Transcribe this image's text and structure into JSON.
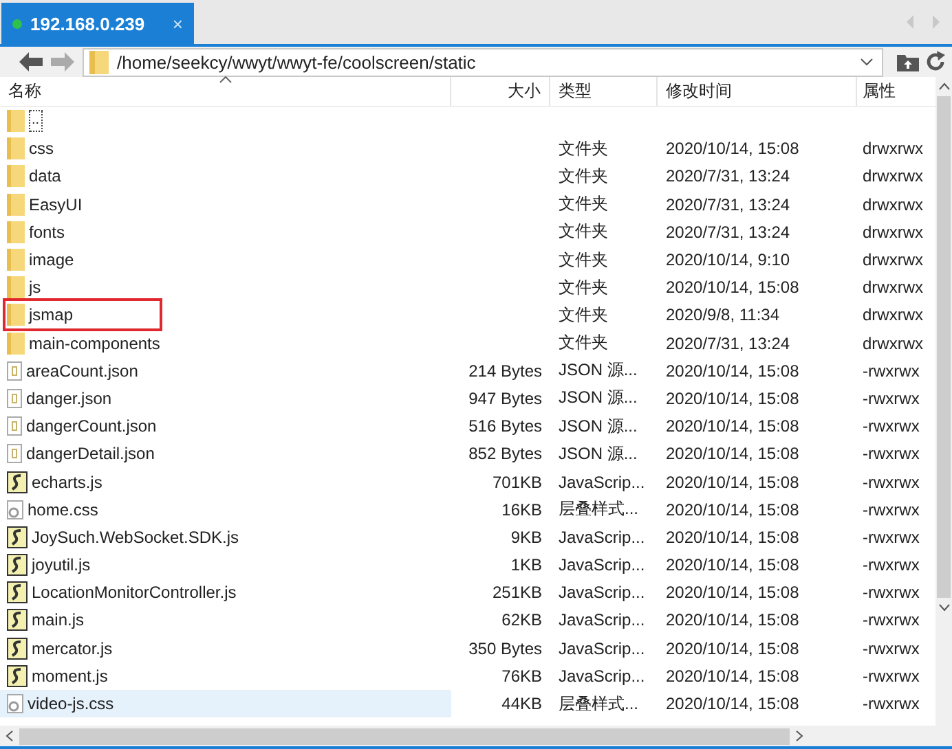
{
  "tab": {
    "title": "192.168.0.239",
    "close": "×",
    "connected": true
  },
  "address": {
    "path": "/home/seekcy/wwyt/wwyt-fe/coolscreen/static"
  },
  "columns": [
    "名称",
    "大小",
    "类型",
    "修改时间",
    "属性"
  ],
  "rows": [
    {
      "kind": "parent",
      "name": "..",
      "size": "",
      "type": "",
      "modified": "",
      "attrs": "",
      "selected": false,
      "highlighted": false
    },
    {
      "kind": "folder",
      "name": "css",
      "size": "",
      "type": "文件夹",
      "modified": "2020/10/14, 15:08",
      "attrs": "drwxrwx",
      "selected": false,
      "highlighted": false
    },
    {
      "kind": "folder",
      "name": "data",
      "size": "",
      "type": "文件夹",
      "modified": "2020/7/31, 13:24",
      "attrs": "drwxrwx",
      "selected": false,
      "highlighted": false
    },
    {
      "kind": "folder",
      "name": "EasyUI",
      "size": "",
      "type": "文件夹",
      "modified": "2020/7/31, 13:24",
      "attrs": "drwxrwx",
      "selected": false,
      "highlighted": false
    },
    {
      "kind": "folder",
      "name": "fonts",
      "size": "",
      "type": "文件夹",
      "modified": "2020/7/31, 13:24",
      "attrs": "drwxrwx",
      "selected": false,
      "highlighted": false
    },
    {
      "kind": "folder",
      "name": "image",
      "size": "",
      "type": "文件夹",
      "modified": "2020/10/14, 9:10",
      "attrs": "drwxrwx",
      "selected": false,
      "highlighted": false
    },
    {
      "kind": "folder",
      "name": "js",
      "size": "",
      "type": "文件夹",
      "modified": "2020/10/14, 15:08",
      "attrs": "drwxrwx",
      "selected": false,
      "highlighted": false
    },
    {
      "kind": "folder",
      "name": "jsmap",
      "size": "",
      "type": "文件夹",
      "modified": "2020/9/8, 11:34",
      "attrs": "drwxrwx",
      "selected": false,
      "highlighted": true
    },
    {
      "kind": "folder",
      "name": "main-components",
      "size": "",
      "type": "文件夹",
      "modified": "2020/7/31, 13:24",
      "attrs": "drwxrwx",
      "selected": false,
      "highlighted": false
    },
    {
      "kind": "json",
      "name": "areaCount.json",
      "size": "214 Bytes",
      "type": "JSON 源...",
      "modified": "2020/10/14, 15:08",
      "attrs": "-rwxrwx",
      "selected": false,
      "highlighted": false
    },
    {
      "kind": "json",
      "name": "danger.json",
      "size": "947 Bytes",
      "type": "JSON 源...",
      "modified": "2020/10/14, 15:08",
      "attrs": "-rwxrwx",
      "selected": false,
      "highlighted": false
    },
    {
      "kind": "json",
      "name": "dangerCount.json",
      "size": "516 Bytes",
      "type": "JSON 源...",
      "modified": "2020/10/14, 15:08",
      "attrs": "-rwxrwx",
      "selected": false,
      "highlighted": false
    },
    {
      "kind": "json",
      "name": "dangerDetail.json",
      "size": "852 Bytes",
      "type": "JSON 源...",
      "modified": "2020/10/14, 15:08",
      "attrs": "-rwxrwx",
      "selected": false,
      "highlighted": false
    },
    {
      "kind": "js",
      "name": "echarts.js",
      "size": "701KB",
      "type": "JavaScrip...",
      "modified": "2020/10/14, 15:08",
      "attrs": "-rwxrwx",
      "selected": false,
      "highlighted": false
    },
    {
      "kind": "css",
      "name": "home.css",
      "size": "16KB",
      "type": "层叠样式...",
      "modified": "2020/10/14, 15:08",
      "attrs": "-rwxrwx",
      "selected": false,
      "highlighted": false
    },
    {
      "kind": "js",
      "name": "JoySuch.WebSocket.SDK.js",
      "size": "9KB",
      "type": "JavaScrip...",
      "modified": "2020/10/14, 15:08",
      "attrs": "-rwxrwx",
      "selected": false,
      "highlighted": false
    },
    {
      "kind": "js",
      "name": "joyutil.js",
      "size": "1KB",
      "type": "JavaScrip...",
      "modified": "2020/10/14, 15:08",
      "attrs": "-rwxrwx",
      "selected": false,
      "highlighted": false
    },
    {
      "kind": "js",
      "name": "LocationMonitorController.js",
      "size": "251KB",
      "type": "JavaScrip...",
      "modified": "2020/10/14, 15:08",
      "attrs": "-rwxrwx",
      "selected": false,
      "highlighted": false
    },
    {
      "kind": "js",
      "name": "main.js",
      "size": "62KB",
      "type": "JavaScrip...",
      "modified": "2020/10/14, 15:08",
      "attrs": "-rwxrwx",
      "selected": false,
      "highlighted": false
    },
    {
      "kind": "js",
      "name": "mercator.js",
      "size": "350 Bytes",
      "type": "JavaScrip...",
      "modified": "2020/10/14, 15:08",
      "attrs": "-rwxrwx",
      "selected": false,
      "highlighted": false
    },
    {
      "kind": "js",
      "name": "moment.js",
      "size": "76KB",
      "type": "JavaScrip...",
      "modified": "2020/10/14, 15:08",
      "attrs": "-rwxrwx",
      "selected": false,
      "highlighted": false
    },
    {
      "kind": "css",
      "name": "video-js.css",
      "size": "44KB",
      "type": "层叠样式...",
      "modified": "2020/10/14, 15:08",
      "attrs": "-rwxrwx",
      "selected": true,
      "highlighted": false
    }
  ]
}
